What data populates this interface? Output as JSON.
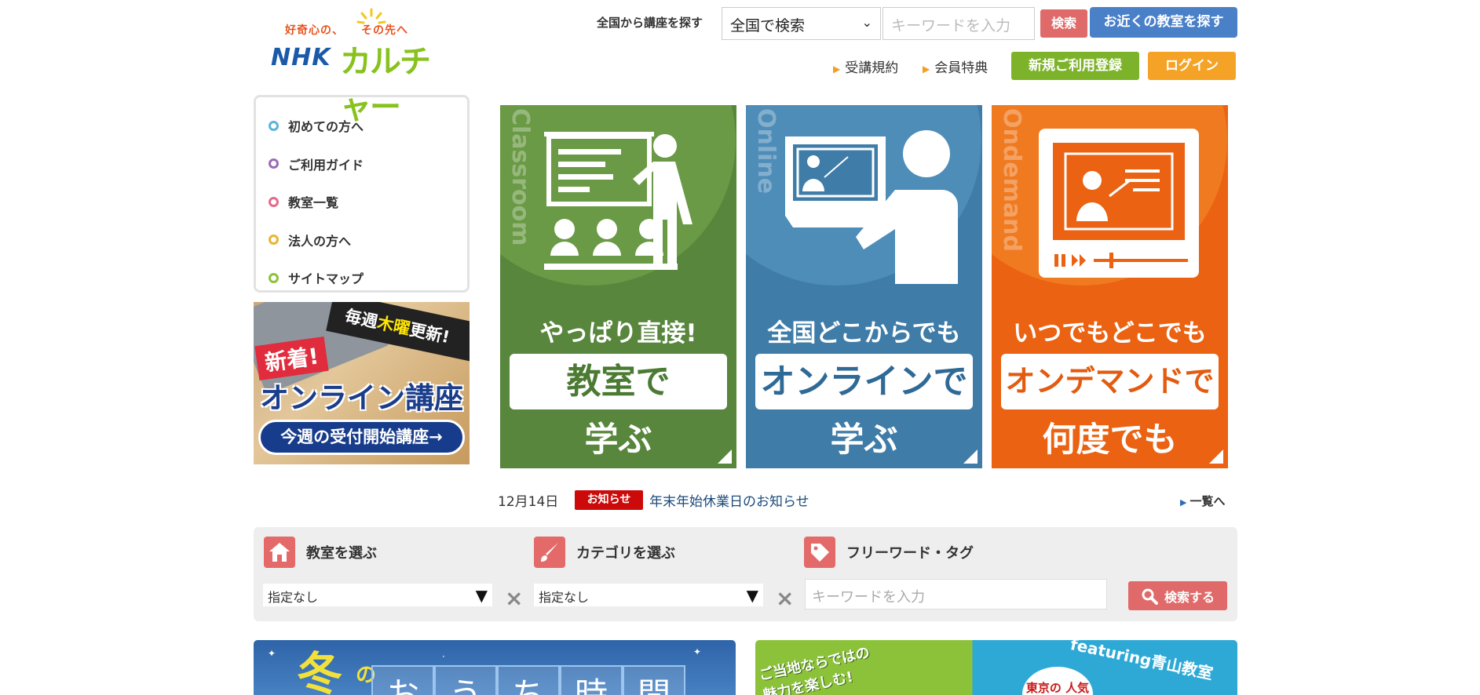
{
  "header": {
    "logo": {
      "tagline_a": "好奇心の、",
      "tagline_b": "その先へ",
      "brand_a": "NHK",
      "brand_b": "カルチャー"
    },
    "search_label": "全国から講座を探す",
    "region_select": "全国で検索",
    "keyword_placeholder": "キーワードを入力",
    "search_button": "検索",
    "nearby_button": "お近くの教室を探す",
    "links": [
      "受講規約",
      "会員特典"
    ],
    "register_button": "新規ご利用登録",
    "login_button": "ログイン"
  },
  "side_menu": [
    {
      "label": "初めての方へ",
      "color": "#5ab4dc"
    },
    {
      "label": "ご利用ガイド",
      "color": "#9b6bb5"
    },
    {
      "label": "教室一覧",
      "color": "#e46a8a"
    },
    {
      "label": "法人の方へ",
      "color": "#e8b432"
    },
    {
      "label": "サイトマップ",
      "color": "#8cc23a"
    }
  ],
  "online_banner": {
    "ribbon_a": "毎週",
    "ribbon_hl": "木曜",
    "ribbon_b": "更新!",
    "new": "新着!",
    "title": "オンライン講座",
    "pill": "今週の受付開始講座→"
  },
  "tiles": [
    {
      "vertical": "Classroom",
      "line1": "やっぱり直接!",
      "box": "教室で",
      "line3": "学ぶ"
    },
    {
      "vertical": "Online",
      "line1": "全国どこからでも",
      "box": "オンラインで",
      "line3": "学ぶ"
    },
    {
      "vertical": "Ondemand",
      "line1": "いつでもどこでも",
      "box": "オンデマンドで",
      "line3": "何度でも"
    }
  ],
  "news": {
    "date": "12月14日",
    "badge": "お知らせ",
    "title": "年末年始休業日のお知らせ",
    "more": "一覧へ"
  },
  "search_panel": {
    "classroom_label": "教室を選ぶ",
    "category_label": "カテゴリを選ぶ",
    "freeword_label": "フリーワード・タグ",
    "classroom_value": "指定なし",
    "category_value": "指定なし",
    "keyword_placeholder": "キーワードを入力",
    "search_button": "検索する"
  },
  "banners": {
    "winter_a": "冬",
    "winter_b": "の",
    "winter_chars": [
      "お",
      "う",
      "ち",
      "時",
      "間"
    ],
    "local_a": "ご当地ならではの",
    "local_b": "魅力を楽しむ!",
    "local_feat": "featuring青山教室",
    "local_tokyo": "東京の 人気講座を"
  },
  "colors": {
    "classroom": "#57863c",
    "online": "#3f7ca8",
    "ondemand": "#ea6212",
    "register": "#7db32a",
    "login": "#f5a326",
    "nearby": "#4a80c8",
    "search": "#e06a6a"
  }
}
